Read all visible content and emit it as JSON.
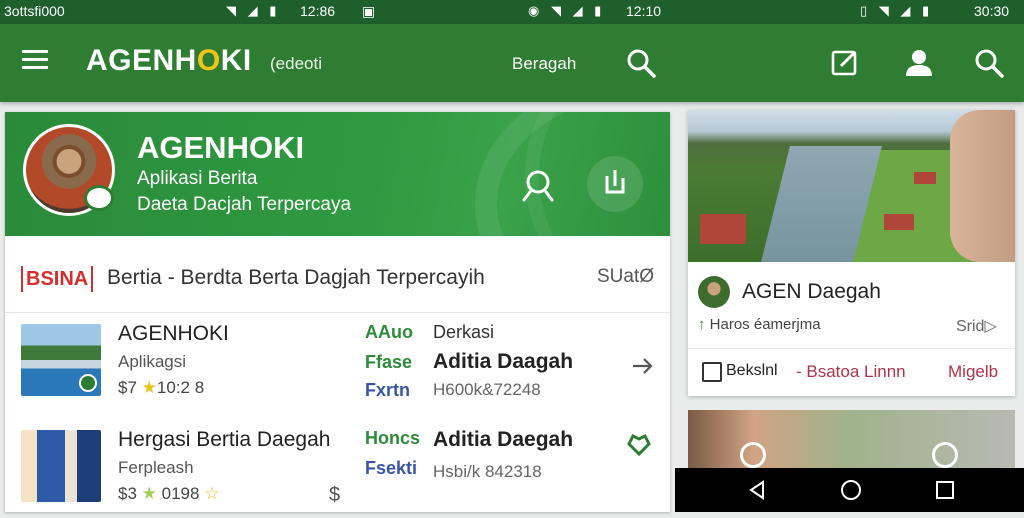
{
  "status_bar": {
    "left_label": "3ottsfi000",
    "time_1": "12:86",
    "time_2": "12:10",
    "time_3": "30:30"
  },
  "app_bar": {
    "logo_main": "AGENH",
    "logo_o": "O",
    "logo_end": "KI",
    "subtitle": "(edeoti",
    "center_label": "Beragah"
  },
  "hero": {
    "title": "AGENHOKI",
    "line1": "Aplikasi Berita",
    "line2": "Daeta Dacjah Terpercaya"
  },
  "ticker": {
    "badge": "BSINA",
    "text": "Bertia - Berdta Berta Dagjah Terpercayih",
    "right": "SUatØ"
  },
  "rows": [
    {
      "title": "AGENHOKI",
      "subtitle": "Aplikagsi",
      "rating_prefix": "$7",
      "rating_value": "10:2 8",
      "tag1": "AAuo",
      "tag2": "Ffase",
      "tag3": "Fxrtn",
      "col_label": "Derkasi",
      "col_title": "Aditia Daagah",
      "col_meta": "H600k&72248"
    },
    {
      "title": "Hergasi Bertia Daegah",
      "subtitle": "Ferpleash",
      "rating_prefix": "$3",
      "rating_value": "0198",
      "tag1": "Honcs",
      "tag2": "Fsekti",
      "tag3": "",
      "col_label": "",
      "col_title": "Aditia Daegah",
      "col_meta": "Hsbi/k 842318"
    }
  ],
  "side_card": {
    "name": "AGEN Daegah",
    "meta_prefix": "↑",
    "meta_text": "Haros éamerjma",
    "meta_right": "Srid▷",
    "footer_1": "Bekslnl",
    "footer_2": "- Bsatoa  Linnn",
    "footer_link": "Migelb"
  },
  "colors": {
    "brand_green": "#2e7d32",
    "status_green": "#1f5f2c",
    "accent_yellow": "#f2c418",
    "badge_red": "#d32f2f"
  },
  "icons": {
    "menu": "hamburger-icon",
    "search": "search-icon",
    "compose": "edit-icon",
    "profile": "person-icon"
  }
}
